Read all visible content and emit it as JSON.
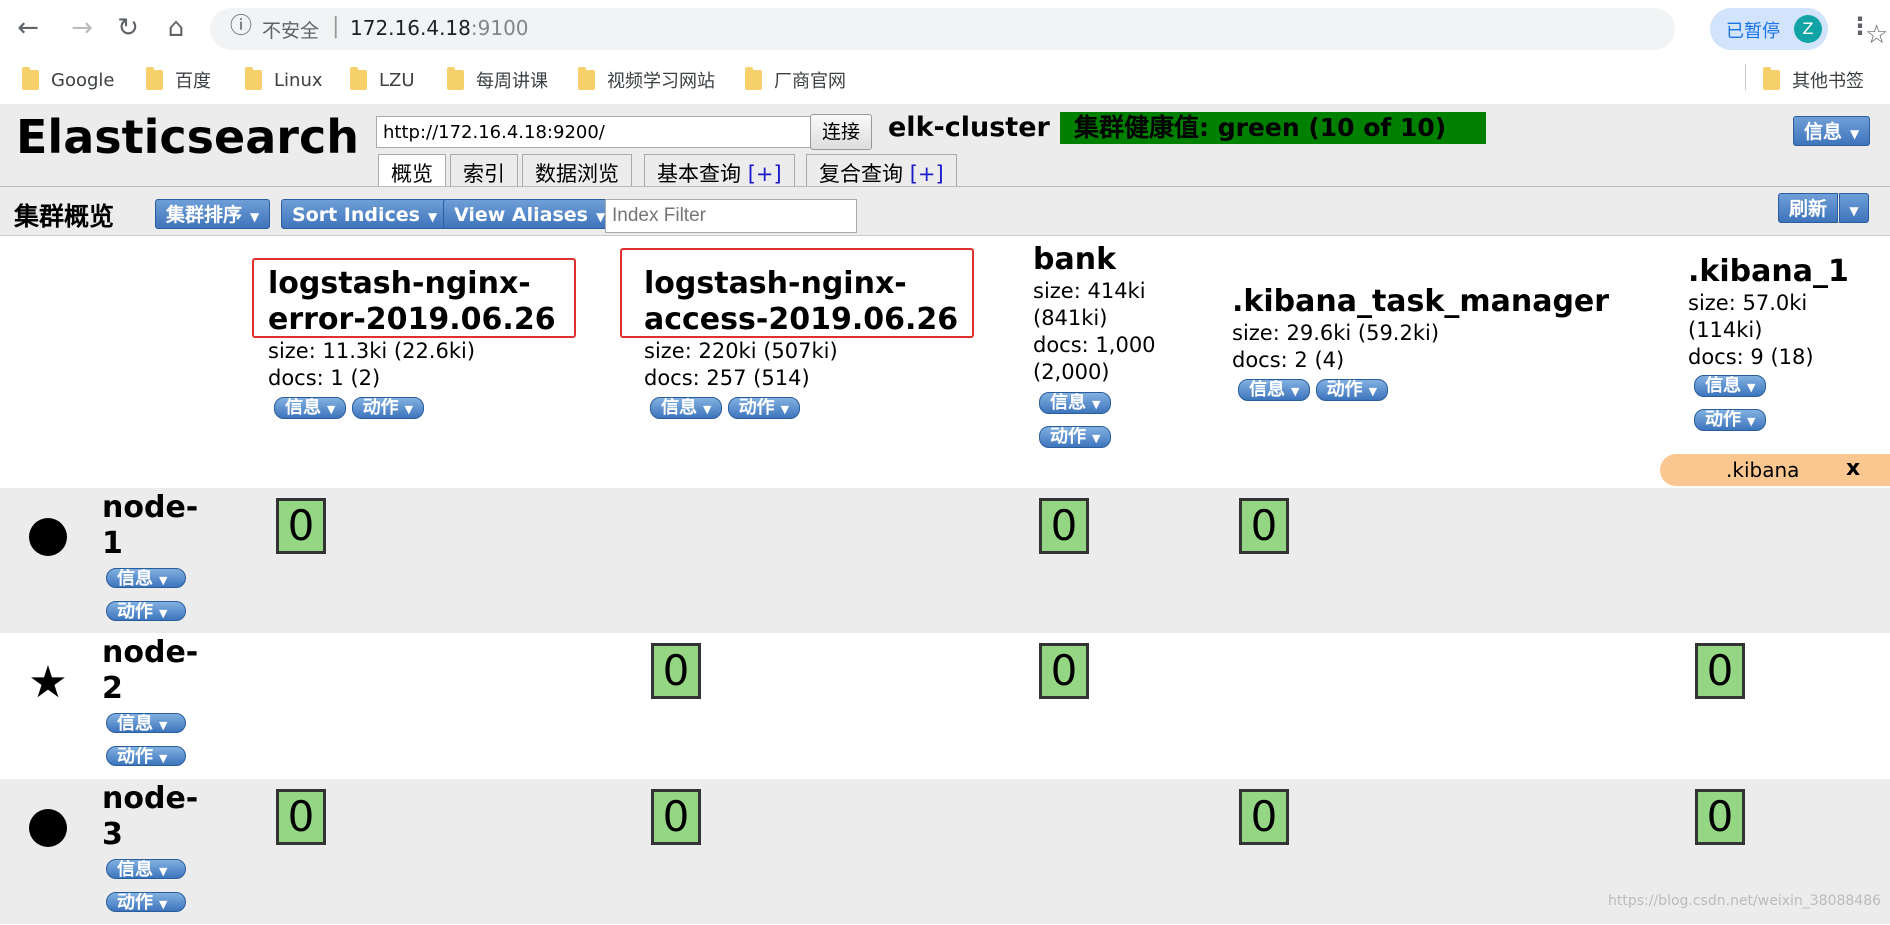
{
  "browser": {
    "insecure_label": "不安全",
    "url_host": "172.16.4.18",
    "url_port": ":9100",
    "paused_label": "已暂停",
    "avatar_letter": "Z",
    "bookmarks": [
      "Google",
      "百度",
      "Linux",
      "LZU",
      "每周讲课",
      "视频学习网站",
      "厂商官网"
    ],
    "other_bookmarks": "其他书签"
  },
  "app": {
    "title": "Elasticsearch",
    "connect_url": "http://172.16.4.18:9200/",
    "connect_label": "连接",
    "cluster_name": "elk-cluster",
    "health": "集群健康值: green (10 of 10)",
    "info_label": "信息",
    "tabs": [
      {
        "label": "概览",
        "plus": ""
      },
      {
        "label": "索引",
        "plus": ""
      },
      {
        "label": "数据浏览",
        "plus": ""
      },
      {
        "label": "基本查询",
        "plus": "[+]"
      },
      {
        "label": "复合查询",
        "plus": "[+]"
      }
    ]
  },
  "toolbar": {
    "title": "集群概览",
    "cluster_sort": "集群排序",
    "sort_indices": "Sort Indices",
    "view_aliases": "View Aliases",
    "index_filter_placeholder": "Index Filter",
    "refresh": "刷新"
  },
  "indices": [
    {
      "name_1": "logstash-nginx-",
      "name_2": "error-2019.06.26",
      "size": "size: 11.3ki (22.6ki)",
      "docs": "docs: 1 (2)",
      "info": "信息",
      "action": "动作"
    },
    {
      "name_1": "logstash-nginx-",
      "name_2": "access-2019.06.26",
      "size": "size: 220ki (507ki)",
      "docs": "docs: 257 (514)",
      "info": "信息",
      "action": "动作"
    },
    {
      "name_1": "bank",
      "size_1": "size: 414ki",
      "size_2": "(841ki)",
      "docs_1": "docs: 1,000",
      "docs_2": "(2,000)",
      "info": "信息",
      "action": "动作"
    },
    {
      "name_1": ".kibana_task_manager",
      "size": "size: 29.6ki (59.2ki)",
      "docs": "docs: 2 (4)",
      "info": "信息",
      "action": "动作"
    },
    {
      "name_1": ".kibana_1",
      "size_1": "size: 57.0ki",
      "size_2": "(114ki)",
      "docs": "docs: 9 (18)",
      "info": "信息",
      "action": "动作"
    }
  ],
  "alias": {
    "name": ".kibana",
    "close": "x"
  },
  "nodes": [
    {
      "name_1": "node-",
      "name_2": "1",
      "icon": "circle-icon",
      "info": "信息",
      "action": "动作",
      "shards": [
        "0",
        "",
        "0",
        "0",
        ""
      ]
    },
    {
      "name_1": "node-",
      "name_2": "2",
      "icon": "star-icon",
      "info": "信息",
      "action": "动作",
      "shards": [
        "",
        "0",
        "0",
        "",
        "0"
      ]
    },
    {
      "name_1": "node-",
      "name_2": "3",
      "icon": "circle-icon",
      "info": "信息",
      "action": "动作",
      "shards": [
        "0",
        "0",
        "",
        "0",
        "0"
      ]
    }
  ],
  "watermark": "https://blog.csdn.net/weixin_38088486",
  "colors": {
    "health_green": "#008000",
    "shard_fill": "#94d683",
    "alias_bg": "#fbc790",
    "highlight_box": "#e03030"
  }
}
